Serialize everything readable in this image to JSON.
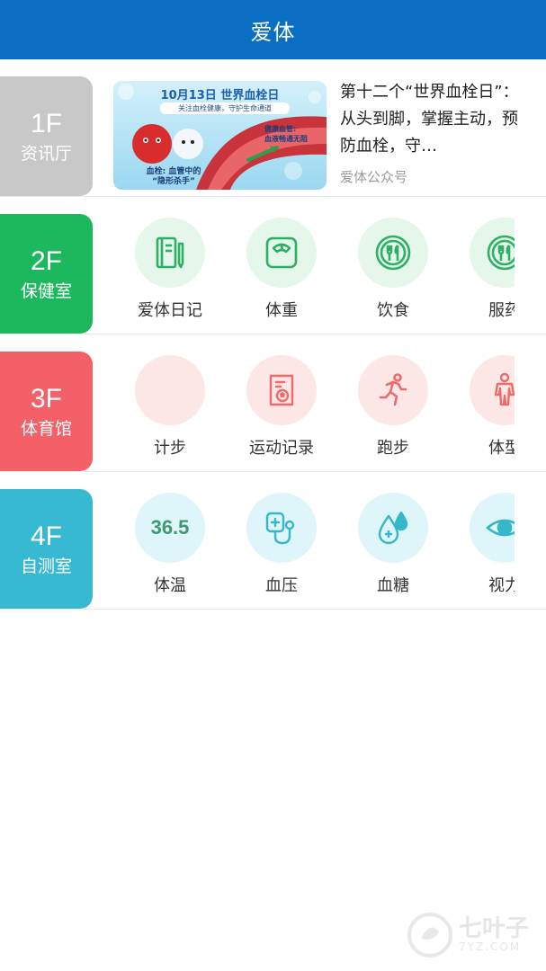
{
  "header": {
    "title": "爱体"
  },
  "floors": [
    {
      "num": "1F",
      "name": "资讯厅",
      "color": "#c8c8c8"
    },
    {
      "num": "2F",
      "name": "保健室",
      "color": "#1db75e"
    },
    {
      "num": "3F",
      "name": "体育馆",
      "color": "#f46068"
    },
    {
      "num": "4F",
      "name": "自测室",
      "color": "#37b9d2"
    }
  ],
  "news": {
    "banner_date": "10月13日",
    "banner_event": "世界血栓日",
    "banner_sub": "关注血栓健康，守护生命通道",
    "banner_right1": "健康血管:",
    "banner_right2": "血液畅通无阻",
    "banner_left1": "血栓: 血管中的",
    "banner_left2": "“隐形杀手”",
    "title": "第十二个“世界血栓日”：从头到脚，掌握主动，预防血栓，守…",
    "source": "爱体公众号"
  },
  "floor2_items": [
    {
      "label": "爱体日记",
      "icon": "diary-icon"
    },
    {
      "label": "体重",
      "icon": "scale-icon"
    },
    {
      "label": "饮食",
      "icon": "meal-icon"
    },
    {
      "label": "服药",
      "icon": "medicine-icon"
    }
  ],
  "floor3_items": [
    {
      "label": "计步",
      "icon": "step-icon"
    },
    {
      "label": "运动记录",
      "icon": "exercise-record-icon"
    },
    {
      "label": "跑步",
      "icon": "running-icon"
    },
    {
      "label": "体型",
      "icon": "body-shape-icon"
    }
  ],
  "floor4_items": [
    {
      "label": "体温",
      "icon": "temperature-icon",
      "value": "36.5"
    },
    {
      "label": "血压",
      "icon": "blood-pressure-icon"
    },
    {
      "label": "血糖",
      "icon": "blood-sugar-icon"
    },
    {
      "label": "视力",
      "icon": "vision-icon"
    }
  ],
  "watermark": {
    "text": "七叶子",
    "sub": "7YZ.COM"
  },
  "colors": {
    "header": "#0a6fc2",
    "green_icon": "#2fae66",
    "red_icon": "#ee6b6b",
    "teal_icon": "#34b7c9"
  }
}
